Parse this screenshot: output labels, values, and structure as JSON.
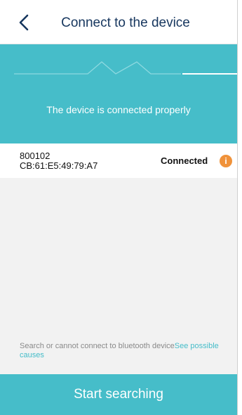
{
  "header": {
    "title": "Connect to the device",
    "back_icon": "chevron-left-icon"
  },
  "banner": {
    "status_text": "The device is connected properly",
    "background_color": "#46bdc9"
  },
  "device": {
    "name": "800102",
    "mac": "CB:61:E5:49:79:A7",
    "status": "Connected",
    "info_icon": "info-icon",
    "info_icon_glyph": "i",
    "info_icon_color": "#f0923a"
  },
  "hint": {
    "text": "Search or cannot connect to bluetooth device",
    "link": "See possible causes"
  },
  "bottom_button": {
    "label": "Start searching"
  }
}
